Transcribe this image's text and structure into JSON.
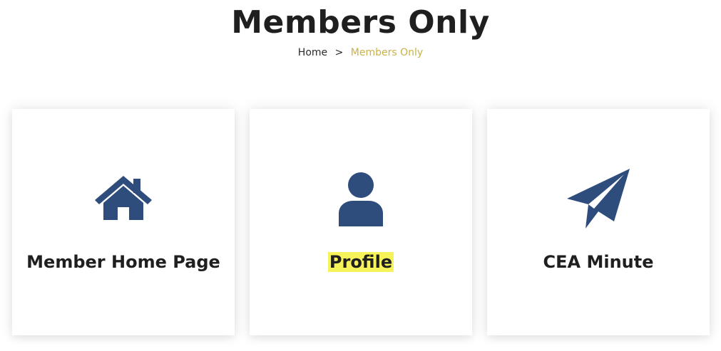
{
  "header": {
    "title": "Members Only"
  },
  "breadcrumb": {
    "home_label": "Home",
    "separator": ">",
    "current_label": "Members Only"
  },
  "cards": [
    {
      "label": "Member Home Page",
      "icon": "house-icon"
    },
    {
      "label": "Profile",
      "icon": "user-icon",
      "highlight_color": "#f6f35a"
    },
    {
      "label": "CEA Minute",
      "icon": "paper-plane-icon"
    }
  ],
  "colors": {
    "icon": "#2e4d7c",
    "breadcrumb_current": "#c8b24a",
    "text": "#1f1f1f"
  }
}
